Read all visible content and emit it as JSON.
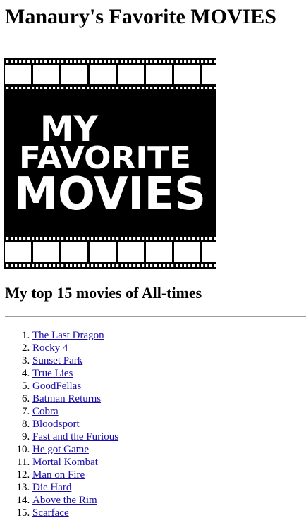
{
  "page": {
    "title": "Manaury's Favorite MOVIES",
    "section_heading": "My top 15 movies of All-times"
  },
  "banner": {
    "line1": "MY",
    "line2": "FAVORITE",
    "line3": "MOVIES"
  },
  "colors": {
    "link": "#1a0dab",
    "text": "#000000",
    "banner_background": "#000000",
    "banner_text": "#ffffff",
    "divider": "#9a9a9a"
  },
  "movies": [
    "The Last Dragon",
    "Rocky 4",
    "Sunset Park",
    "True Lies",
    "GoodFellas",
    "Batman Returns",
    "Cobra",
    "Bloodsport",
    "Fast and the Furious",
    "He got Game",
    "Mortal Kombat",
    "Man on Fire",
    "Die Hard",
    "Above the Rim",
    "Scarface"
  ]
}
